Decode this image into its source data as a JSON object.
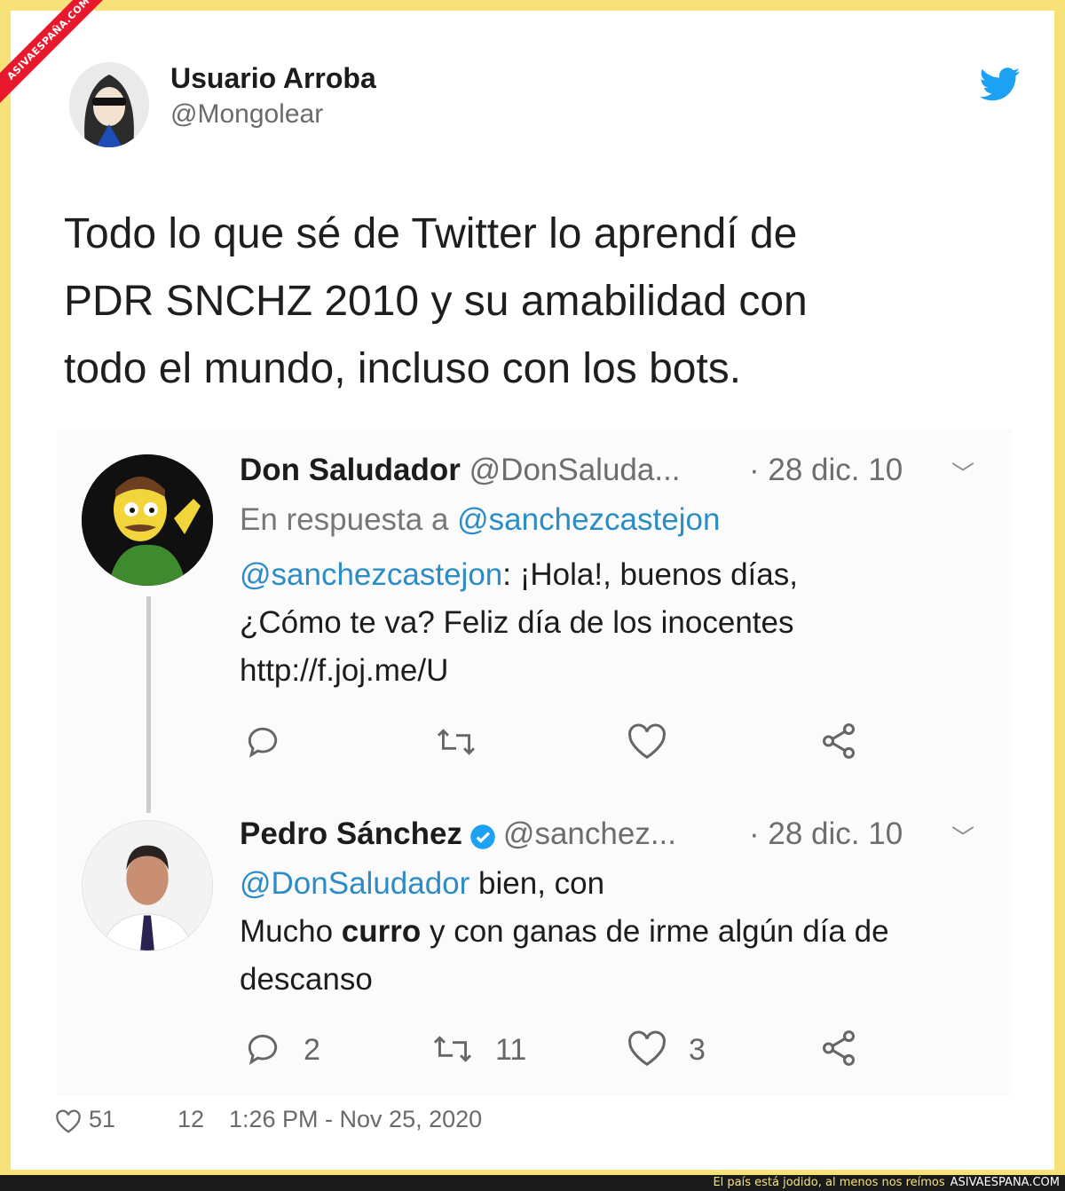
{
  "watermark": {
    "ribbon": "ASIVAESPAÑA.COM"
  },
  "author": {
    "name": "Usuario Arroba",
    "handle": "@Mongolear"
  },
  "tweet": {
    "lines": [
      "Todo lo que sé de Twitter lo aprendí de",
      "PDR SNCHZ 2010 y su amabilidad con",
      "todo el mundo, incluso con los bots."
    ]
  },
  "embedded": {
    "first": {
      "name": "Don Saludador",
      "handle": "@DonSaluda...",
      "date": "· 28 dic. 10",
      "reply_prefix": "En respuesta a ",
      "reply_to": "@sanchezcastejon",
      "mention": "@sanchezcastejon",
      "line1_rest": ": ¡Hola!, buenos días,",
      "line2": "¿Cómo te va? Feliz día de los inocentes",
      "line3": "http://f.joj.me/U"
    },
    "second": {
      "name": "Pedro Sánchez",
      "handle": "@sanchez...",
      "date": "· 28 dic. 10",
      "mention": "@DonSaludador",
      "line1_rest": " bien, con",
      "line2_pre": "Mucho ",
      "line2_bold": "curro",
      "line2_post": " y con ganas de irme algún día de",
      "line3": "descanso",
      "replies": "2",
      "retweets": "11",
      "likes": "3"
    }
  },
  "footer": {
    "likes": "51",
    "retweets": "12",
    "timestamp": "1:26 PM - Nov 25, 2020"
  },
  "bottom_bar": {
    "caption": "El país está jodido, al menos nos reímos",
    "brand": "ASIVAESPANA.COM"
  },
  "colors": {
    "accent": "#1da1f2",
    "mention": "#2b8cc6",
    "background": "#f7e27a"
  }
}
